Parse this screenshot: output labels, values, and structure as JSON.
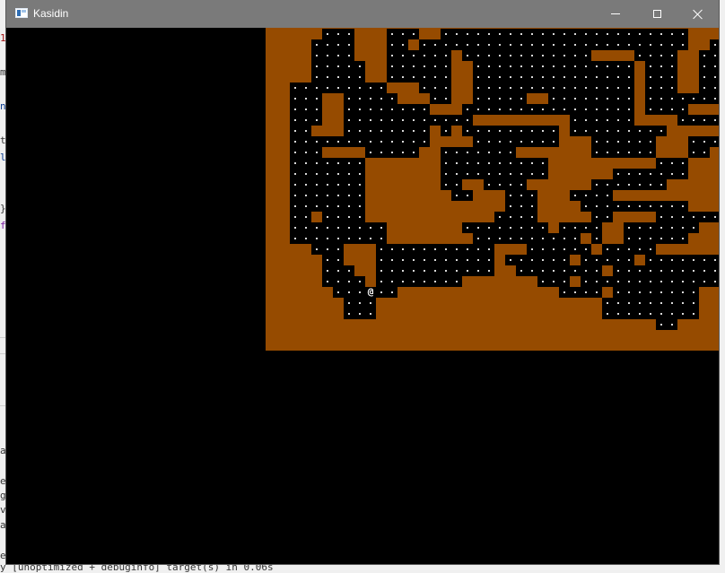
{
  "window": {
    "title": "Kasidin",
    "icon": "app-window-icon",
    "controls": [
      "minimize-icon",
      "maximize-icon",
      "close-icon"
    ]
  },
  "game": {
    "player_glyph": "@",
    "colors": {
      "rock": "#964b00",
      "floor": "#000000",
      "floor_dot": "#d8d8d8",
      "player": "#ffffff"
    },
    "player": {
      "row": 24,
      "col": 9
    },
    "floor_rows": [
      [
        [
          5,
          7
        ],
        [
          11,
          13
        ],
        [
          16,
          38
        ]
      ],
      [
        [
          4,
          7
        ],
        [
          11,
          12
        ],
        [
          14,
          38
        ],
        [
          41,
          42
        ]
      ],
      [
        [
          4,
          7
        ],
        [
          11,
          16
        ],
        [
          18,
          29
        ],
        [
          34,
          37
        ],
        [
          40,
          42
        ]
      ],
      [
        [
          4,
          8
        ],
        [
          11,
          16
        ],
        [
          19,
          33
        ],
        [
          35,
          37
        ],
        [
          40,
          42
        ]
      ],
      [
        [
          4,
          8
        ],
        [
          11,
          16
        ],
        [
          19,
          33
        ],
        [
          35,
          37
        ],
        [
          40,
          42
        ]
      ],
      [
        [
          2,
          10
        ],
        [
          14,
          16
        ],
        [
          19,
          33
        ],
        [
          35,
          37
        ],
        [
          40,
          42
        ]
      ],
      [
        [
          2,
          4
        ],
        [
          7,
          11
        ],
        [
          15,
          16
        ],
        [
          19,
          23
        ],
        [
          26,
          33
        ],
        [
          35,
          42
        ]
      ],
      [
        [
          2,
          4
        ],
        [
          7,
          14
        ],
        [
          18,
          33
        ],
        [
          35,
          38
        ]
      ],
      [
        [
          2,
          4
        ],
        [
          7,
          18
        ],
        [
          28,
          33
        ],
        [
          38,
          43
        ]
      ],
      [
        [
          2,
          3
        ],
        [
          7,
          14
        ],
        [
          16,
          16
        ],
        [
          18,
          26
        ],
        [
          28,
          36
        ]
      ],
      [
        [
          2,
          14
        ],
        [
          19,
          26
        ],
        [
          30,
          35
        ],
        [
          39,
          42
        ]
      ],
      [
        [
          2,
          4
        ],
        [
          9,
          13
        ],
        [
          16,
          22
        ],
        [
          30,
          35
        ],
        [
          39,
          40
        ]
      ],
      [
        [
          2,
          8
        ],
        [
          16,
          25
        ],
        [
          36,
          38
        ]
      ],
      [
        [
          2,
          8
        ],
        [
          16,
          25
        ],
        [
          32,
          38
        ]
      ],
      [
        [
          2,
          8
        ],
        [
          16,
          17
        ],
        [
          20,
          23
        ],
        [
          30,
          36
        ]
      ],
      [
        [
          2,
          8
        ],
        [
          17,
          18
        ],
        [
          22,
          24
        ],
        [
          28,
          31
        ]
      ],
      [
        [
          2,
          8
        ],
        [
          22,
          24
        ],
        [
          29,
          38
        ]
      ],
      [
        [
          2,
          3
        ],
        [
          5,
          8
        ],
        [
          21,
          24
        ],
        [
          30,
          31
        ],
        [
          36,
          41
        ]
      ],
      [
        [
          2,
          10
        ],
        [
          18,
          25
        ],
        [
          27,
          30
        ],
        [
          33,
          39
        ]
      ],
      [
        [
          2,
          10
        ],
        [
          19,
          28
        ],
        [
          30,
          30
        ],
        [
          33,
          38
        ]
      ],
      [
        [
          4,
          6
        ],
        [
          10,
          20
        ],
        [
          24,
          29
        ],
        [
          31,
          35
        ],
        [
          42,
          42
        ]
      ],
      [
        [
          5,
          6
        ],
        [
          10,
          20
        ],
        [
          22,
          27
        ],
        [
          29,
          33
        ],
        [
          35,
          42
        ]
      ],
      [
        [
          5,
          7
        ],
        [
          10,
          20
        ],
        [
          23,
          30
        ],
        [
          32,
          41
        ]
      ],
      [
        [
          5,
          8
        ],
        [
          10,
          17
        ],
        [
          25,
          27
        ],
        [
          29,
          41
        ]
      ],
      [
        [
          6,
          11
        ],
        [
          27,
          30
        ],
        [
          32,
          39
        ]
      ],
      [
        [
          7,
          9
        ],
        [
          31,
          39
        ]
      ],
      [
        [
          7,
          9
        ],
        [
          31,
          39
        ]
      ],
      [
        [
          36,
          37
        ]
      ]
    ]
  }
}
